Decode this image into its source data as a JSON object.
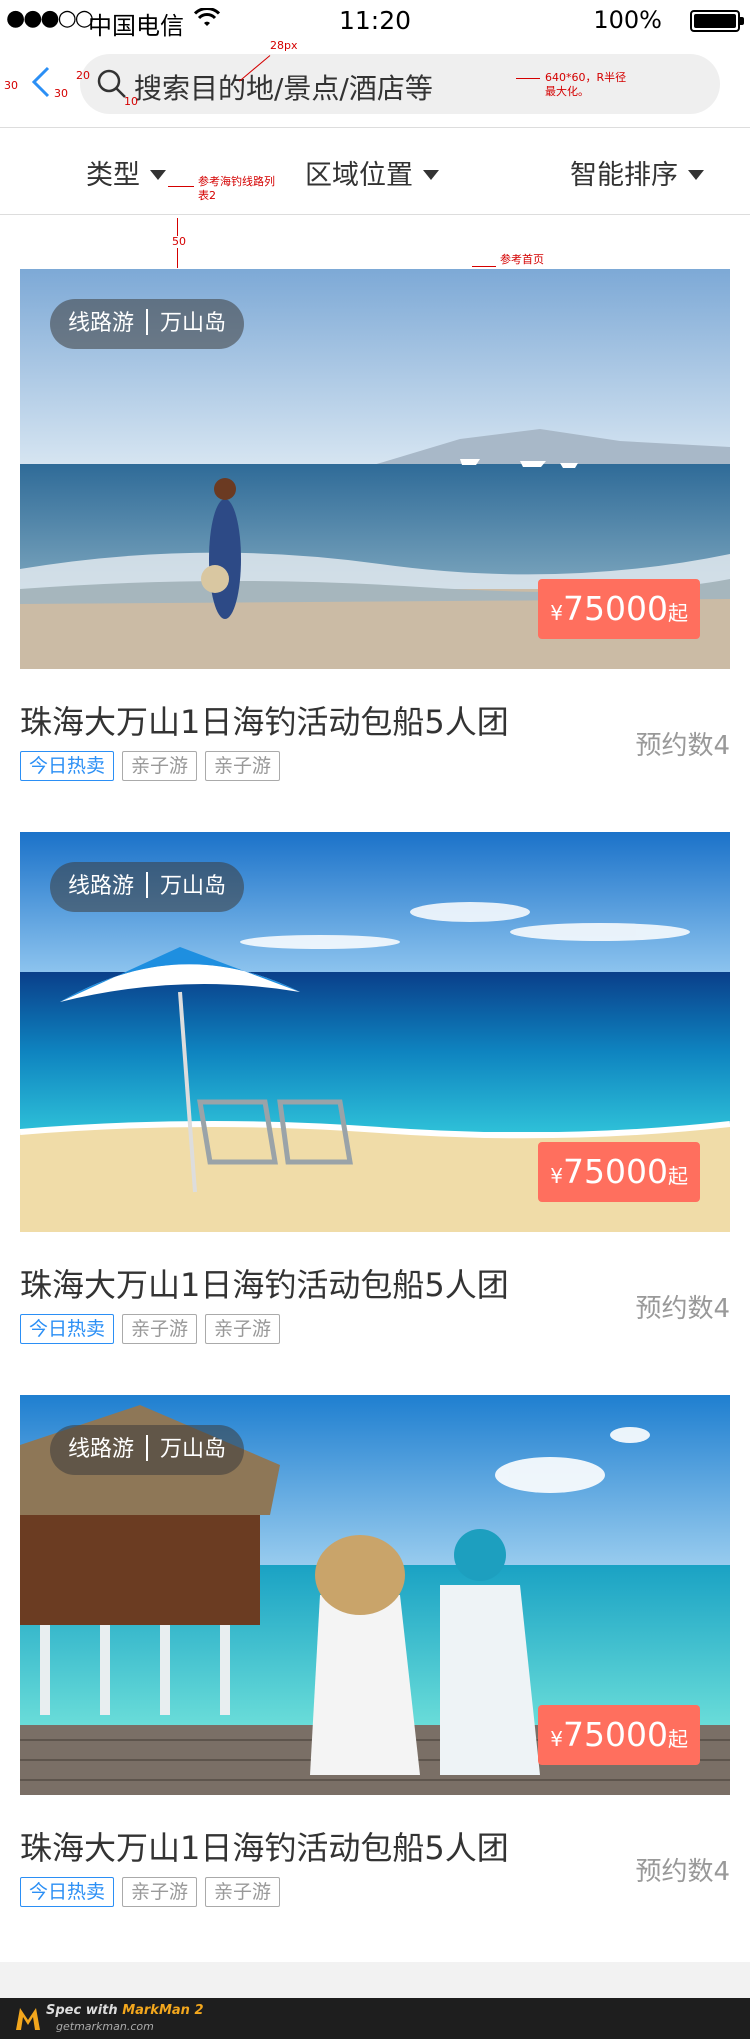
{
  "status_bar": {
    "signal": "●●●○○",
    "carrier": "中国电信",
    "time": "11:20",
    "battery": "100%"
  },
  "search": {
    "placeholder": "搜索目的地/景点/酒店等"
  },
  "filters": {
    "type": "类型",
    "area": "区域位置",
    "sort": "智能排序"
  },
  "annotations": {
    "a30_left": "30",
    "a20": "20",
    "a30_inner": "30",
    "a10": "10",
    "a28px": "28px",
    "search_spec_1": "640*60，R半径",
    "search_spec_2": "最大化。",
    "filter_ref_1": "参考海钓线路列",
    "filter_ref_2": "表2",
    "spacing_50": "50",
    "ref_home": "参考首页"
  },
  "cards": [
    {
      "route_type": "线路游",
      "location": "万山岛",
      "currency": "¥",
      "price": "75000",
      "price_suffix": "起",
      "title": "珠海大万山1日海钓活动包船5人团",
      "bookings": "预约数4",
      "tags": [
        "今日热卖",
        "亲子游",
        "亲子游"
      ],
      "photo": "beach-woman-walking"
    },
    {
      "route_type": "线路游",
      "location": "万山岛",
      "currency": "¥",
      "price": "75000",
      "price_suffix": "起",
      "title": "珠海大万山1日海钓活动包船5人团",
      "bookings": "预约数4",
      "tags": [
        "今日热卖",
        "亲子游",
        "亲子游"
      ],
      "photo": "beach-umbrella-chairs"
    },
    {
      "route_type": "线路游",
      "location": "万山岛",
      "currency": "¥",
      "price": "75000",
      "price_suffix": "起",
      "title": "珠海大万山1日海钓活动包船5人团",
      "bookings": "预约数4",
      "tags": [
        "今日热卖",
        "亲子游",
        "亲子游"
      ],
      "photo": "couple-on-pier"
    }
  ],
  "footer": {
    "brand_prefix": "Spec with ",
    "brand_name": "MarkMan 2",
    "site": "getmarkman.com"
  },
  "colors": {
    "price_bg": "#ff6f5e",
    "hot_tag": "#2b8ff5",
    "search_bg": "#efefef"
  }
}
